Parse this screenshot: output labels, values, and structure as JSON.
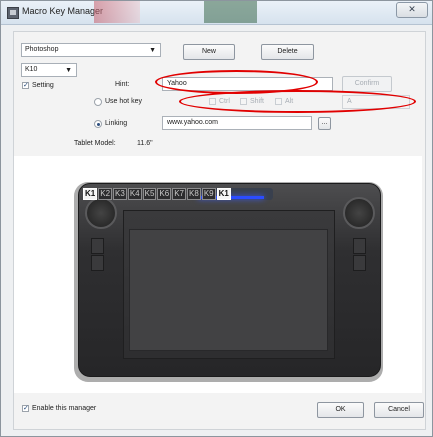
{
  "window": {
    "title": "Macro Key Manager",
    "close_glyph": "✕"
  },
  "app": {
    "application_select": "Photoshop",
    "key_select": "K10",
    "new_label": "New",
    "delete_label": "Delete",
    "setting_label": "Setting",
    "setting_checked": true,
    "hint_label": "Hint:",
    "hint_value": "Yahoo",
    "confirm_label": "Confirm",
    "use_hotkey_label": "Use hot key",
    "ctrl_label": "Ctrl",
    "shift_label": "Shift",
    "alt_label": "Alt",
    "hotkey_key": "A",
    "linking_label": "Linking",
    "linking_value": "www.yahoo.com",
    "browse_label": "...",
    "tablet_model_label": "Tablet Model:",
    "tablet_model_value": "11.6\"",
    "enable_label": "Enable this manager",
    "enable_checked": true,
    "ok_label": "OK",
    "cancel_label": "Cancel"
  },
  "tablet": {
    "keys": [
      "K1",
      "K2",
      "K3",
      "K4",
      "K5",
      "K6",
      "K7",
      "K8",
      "K9",
      "K1"
    ],
    "active_keys": [
      0,
      9
    ]
  },
  "colors": {
    "annotation": "#e10000",
    "led": "#2b4cff"
  }
}
